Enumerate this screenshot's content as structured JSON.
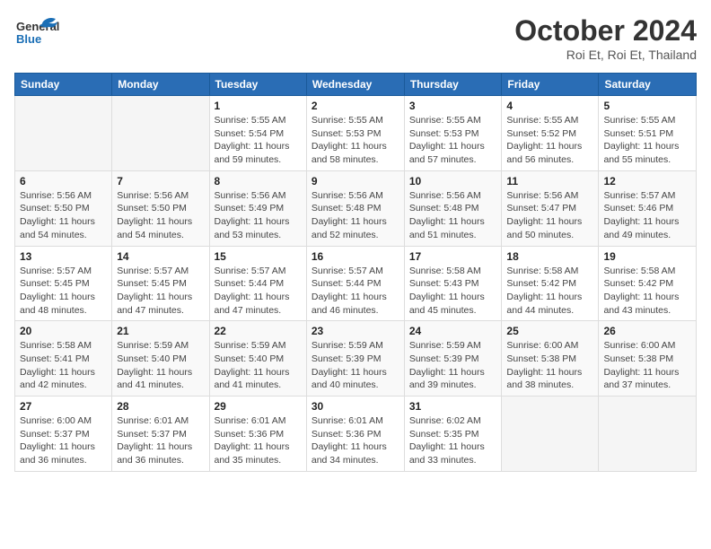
{
  "header": {
    "logo": {
      "general": "General",
      "blue": "Blue"
    },
    "title": "October 2024",
    "subtitle": "Roi Et, Roi Et, Thailand"
  },
  "calendar": {
    "weekdays": [
      "Sunday",
      "Monday",
      "Tuesday",
      "Wednesday",
      "Thursday",
      "Friday",
      "Saturday"
    ],
    "weeks": [
      [
        {
          "day": "",
          "sunrise": "",
          "sunset": "",
          "daylight": ""
        },
        {
          "day": "",
          "sunrise": "",
          "sunset": "",
          "daylight": ""
        },
        {
          "day": "1",
          "sunrise": "Sunrise: 5:55 AM",
          "sunset": "Sunset: 5:54 PM",
          "daylight": "Daylight: 11 hours and 59 minutes."
        },
        {
          "day": "2",
          "sunrise": "Sunrise: 5:55 AM",
          "sunset": "Sunset: 5:53 PM",
          "daylight": "Daylight: 11 hours and 58 minutes."
        },
        {
          "day": "3",
          "sunrise": "Sunrise: 5:55 AM",
          "sunset": "Sunset: 5:53 PM",
          "daylight": "Daylight: 11 hours and 57 minutes."
        },
        {
          "day": "4",
          "sunrise": "Sunrise: 5:55 AM",
          "sunset": "Sunset: 5:52 PM",
          "daylight": "Daylight: 11 hours and 56 minutes."
        },
        {
          "day": "5",
          "sunrise": "Sunrise: 5:55 AM",
          "sunset": "Sunset: 5:51 PM",
          "daylight": "Daylight: 11 hours and 55 minutes."
        }
      ],
      [
        {
          "day": "6",
          "sunrise": "Sunrise: 5:56 AM",
          "sunset": "Sunset: 5:50 PM",
          "daylight": "Daylight: 11 hours and 54 minutes."
        },
        {
          "day": "7",
          "sunrise": "Sunrise: 5:56 AM",
          "sunset": "Sunset: 5:50 PM",
          "daylight": "Daylight: 11 hours and 54 minutes."
        },
        {
          "day": "8",
          "sunrise": "Sunrise: 5:56 AM",
          "sunset": "Sunset: 5:49 PM",
          "daylight": "Daylight: 11 hours and 53 minutes."
        },
        {
          "day": "9",
          "sunrise": "Sunrise: 5:56 AM",
          "sunset": "Sunset: 5:48 PM",
          "daylight": "Daylight: 11 hours and 52 minutes."
        },
        {
          "day": "10",
          "sunrise": "Sunrise: 5:56 AM",
          "sunset": "Sunset: 5:48 PM",
          "daylight": "Daylight: 11 hours and 51 minutes."
        },
        {
          "day": "11",
          "sunrise": "Sunrise: 5:56 AM",
          "sunset": "Sunset: 5:47 PM",
          "daylight": "Daylight: 11 hours and 50 minutes."
        },
        {
          "day": "12",
          "sunrise": "Sunrise: 5:57 AM",
          "sunset": "Sunset: 5:46 PM",
          "daylight": "Daylight: 11 hours and 49 minutes."
        }
      ],
      [
        {
          "day": "13",
          "sunrise": "Sunrise: 5:57 AM",
          "sunset": "Sunset: 5:45 PM",
          "daylight": "Daylight: 11 hours and 48 minutes."
        },
        {
          "day": "14",
          "sunrise": "Sunrise: 5:57 AM",
          "sunset": "Sunset: 5:45 PM",
          "daylight": "Daylight: 11 hours and 47 minutes."
        },
        {
          "day": "15",
          "sunrise": "Sunrise: 5:57 AM",
          "sunset": "Sunset: 5:44 PM",
          "daylight": "Daylight: 11 hours and 47 minutes."
        },
        {
          "day": "16",
          "sunrise": "Sunrise: 5:57 AM",
          "sunset": "Sunset: 5:44 PM",
          "daylight": "Daylight: 11 hours and 46 minutes."
        },
        {
          "day": "17",
          "sunrise": "Sunrise: 5:58 AM",
          "sunset": "Sunset: 5:43 PM",
          "daylight": "Daylight: 11 hours and 45 minutes."
        },
        {
          "day": "18",
          "sunrise": "Sunrise: 5:58 AM",
          "sunset": "Sunset: 5:42 PM",
          "daylight": "Daylight: 11 hours and 44 minutes."
        },
        {
          "day": "19",
          "sunrise": "Sunrise: 5:58 AM",
          "sunset": "Sunset: 5:42 PM",
          "daylight": "Daylight: 11 hours and 43 minutes."
        }
      ],
      [
        {
          "day": "20",
          "sunrise": "Sunrise: 5:58 AM",
          "sunset": "Sunset: 5:41 PM",
          "daylight": "Daylight: 11 hours and 42 minutes."
        },
        {
          "day": "21",
          "sunrise": "Sunrise: 5:59 AM",
          "sunset": "Sunset: 5:40 PM",
          "daylight": "Daylight: 11 hours and 41 minutes."
        },
        {
          "day": "22",
          "sunrise": "Sunrise: 5:59 AM",
          "sunset": "Sunset: 5:40 PM",
          "daylight": "Daylight: 11 hours and 41 minutes."
        },
        {
          "day": "23",
          "sunrise": "Sunrise: 5:59 AM",
          "sunset": "Sunset: 5:39 PM",
          "daylight": "Daylight: 11 hours and 40 minutes."
        },
        {
          "day": "24",
          "sunrise": "Sunrise: 5:59 AM",
          "sunset": "Sunset: 5:39 PM",
          "daylight": "Daylight: 11 hours and 39 minutes."
        },
        {
          "day": "25",
          "sunrise": "Sunrise: 6:00 AM",
          "sunset": "Sunset: 5:38 PM",
          "daylight": "Daylight: 11 hours and 38 minutes."
        },
        {
          "day": "26",
          "sunrise": "Sunrise: 6:00 AM",
          "sunset": "Sunset: 5:38 PM",
          "daylight": "Daylight: 11 hours and 37 minutes."
        }
      ],
      [
        {
          "day": "27",
          "sunrise": "Sunrise: 6:00 AM",
          "sunset": "Sunset: 5:37 PM",
          "daylight": "Daylight: 11 hours and 36 minutes."
        },
        {
          "day": "28",
          "sunrise": "Sunrise: 6:01 AM",
          "sunset": "Sunset: 5:37 PM",
          "daylight": "Daylight: 11 hours and 36 minutes."
        },
        {
          "day": "29",
          "sunrise": "Sunrise: 6:01 AM",
          "sunset": "Sunset: 5:36 PM",
          "daylight": "Daylight: 11 hours and 35 minutes."
        },
        {
          "day": "30",
          "sunrise": "Sunrise: 6:01 AM",
          "sunset": "Sunset: 5:36 PM",
          "daylight": "Daylight: 11 hours and 34 minutes."
        },
        {
          "day": "31",
          "sunrise": "Sunrise: 6:02 AM",
          "sunset": "Sunset: 5:35 PM",
          "daylight": "Daylight: 11 hours and 33 minutes."
        },
        {
          "day": "",
          "sunrise": "",
          "sunset": "",
          "daylight": ""
        },
        {
          "day": "",
          "sunrise": "",
          "sunset": "",
          "daylight": ""
        }
      ]
    ]
  }
}
